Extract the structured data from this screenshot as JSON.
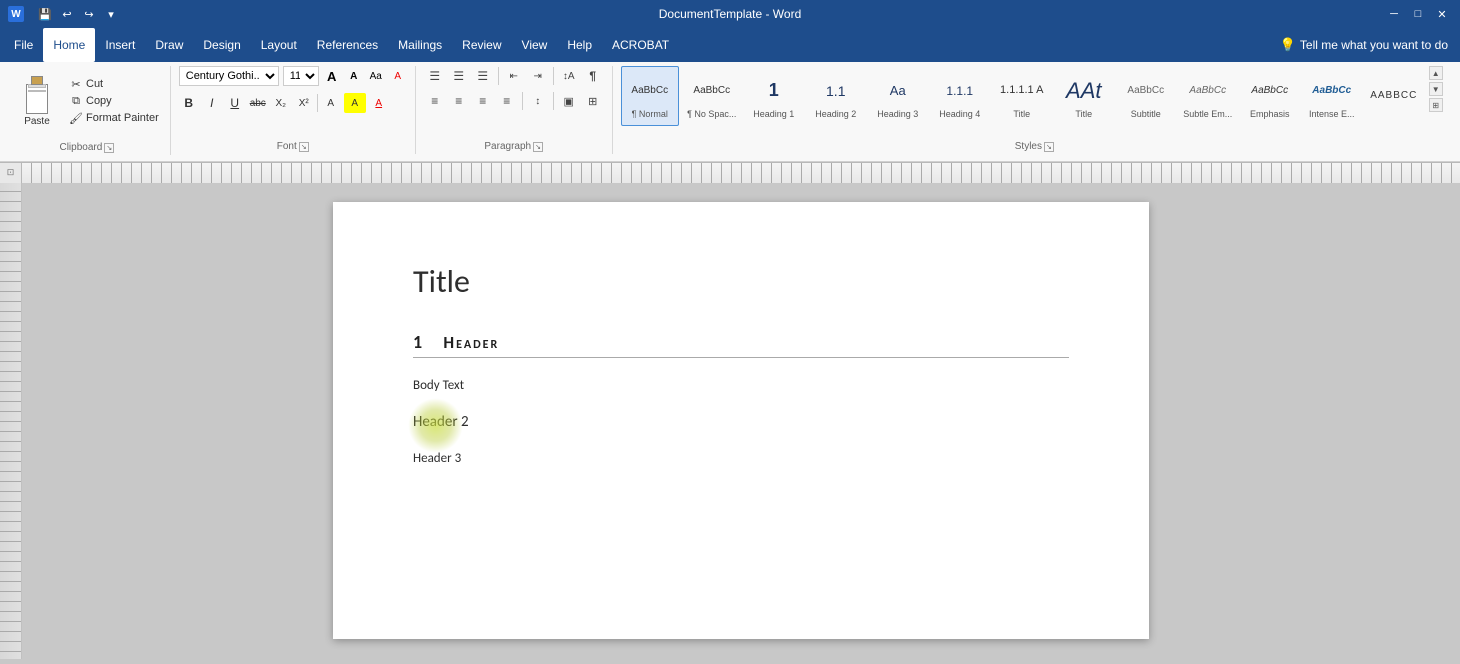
{
  "titlebar": {
    "title": "DocumentTemplate - Word",
    "save_icon": "💾",
    "undo_icon": "↩",
    "redo_icon": "↪",
    "more_icon": "▾",
    "minimize": "─",
    "restore": "□",
    "close": "✕"
  },
  "menubar": {
    "items": [
      {
        "label": "File",
        "active": false
      },
      {
        "label": "Home",
        "active": true
      },
      {
        "label": "Insert",
        "active": false
      },
      {
        "label": "Draw",
        "active": false
      },
      {
        "label": "Design",
        "active": false
      },
      {
        "label": "Layout",
        "active": false
      },
      {
        "label": "References",
        "active": false
      },
      {
        "label": "Mailings",
        "active": false
      },
      {
        "label": "Review",
        "active": false
      },
      {
        "label": "View",
        "active": false
      },
      {
        "label": "Help",
        "active": false
      },
      {
        "label": "ACROBAT",
        "active": false
      }
    ],
    "tell_placeholder": "Tell me what you want to do"
  },
  "ribbon": {
    "clipboard": {
      "label": "Clipboard",
      "paste_label": "Paste",
      "cut_label": "Cut",
      "copy_label": "Copy",
      "format_painter_label": "Format Painter"
    },
    "font": {
      "label": "Font",
      "font_name": "Century Gothi...",
      "font_size": "11",
      "grow_label": "A",
      "shrink_label": "A",
      "case_label": "Aa",
      "clear_label": "A",
      "bold_label": "B",
      "italic_label": "I",
      "underline_label": "U",
      "strike_label": "abc",
      "sub_label": "X₂",
      "sup_label": "X²",
      "highlight_label": "A",
      "font_color_label": "A"
    },
    "paragraph": {
      "label": "Paragraph",
      "bullets_label": "≡",
      "numbering_label": "≡",
      "multilevel_label": "≡",
      "indent_dec_label": "←",
      "indent_inc_label": "→",
      "sort_label": "↕A",
      "show_para_label": "¶",
      "align_left_label": "≡",
      "align_center_label": "≡",
      "align_right_label": "≡",
      "justify_label": "≡",
      "line_spacing_label": "↕",
      "shading_label": "▣",
      "borders_label": "□"
    },
    "styles": {
      "label": "Styles",
      "items": [
        {
          "preview": "AaBbCc",
          "label": "¶ Normal",
          "selected": true
        },
        {
          "preview": "AaBbCc",
          "label": "¶ No Spac...",
          "selected": false
        },
        {
          "preview": "1",
          "label": "Heading 1",
          "selected": false,
          "style": "heading1"
        },
        {
          "preview": "1.1",
          "label": "Heading 2",
          "selected": false,
          "style": "heading2"
        },
        {
          "preview": "Aa",
          "label": "Heading 3",
          "selected": false
        },
        {
          "preview": "1.1.1",
          "label": "Heading 4",
          "selected": false
        },
        {
          "preview": "1.1.1.1 A",
          "label": "Title",
          "selected": false,
          "style": "title"
        },
        {
          "preview": "AAt",
          "label": "Title",
          "selected": false
        },
        {
          "preview": "AaBbCc",
          "label": "Subtitle",
          "selected": false
        },
        {
          "preview": "AaBbCc",
          "label": "Subtle Em...",
          "selected": false
        },
        {
          "preview": "AaBbCc",
          "label": "Emphasis",
          "selected": false
        },
        {
          "preview": "AaBbCc",
          "label": "Intense E...",
          "selected": false
        },
        {
          "preview": "AABBCC",
          "label": "",
          "selected": false
        }
      ]
    }
  },
  "document": {
    "title": "Title",
    "heading1_num": "1",
    "heading1_text": "Header",
    "body_text": "Body Text",
    "heading2": "Header 2",
    "heading3": "Header 3"
  }
}
